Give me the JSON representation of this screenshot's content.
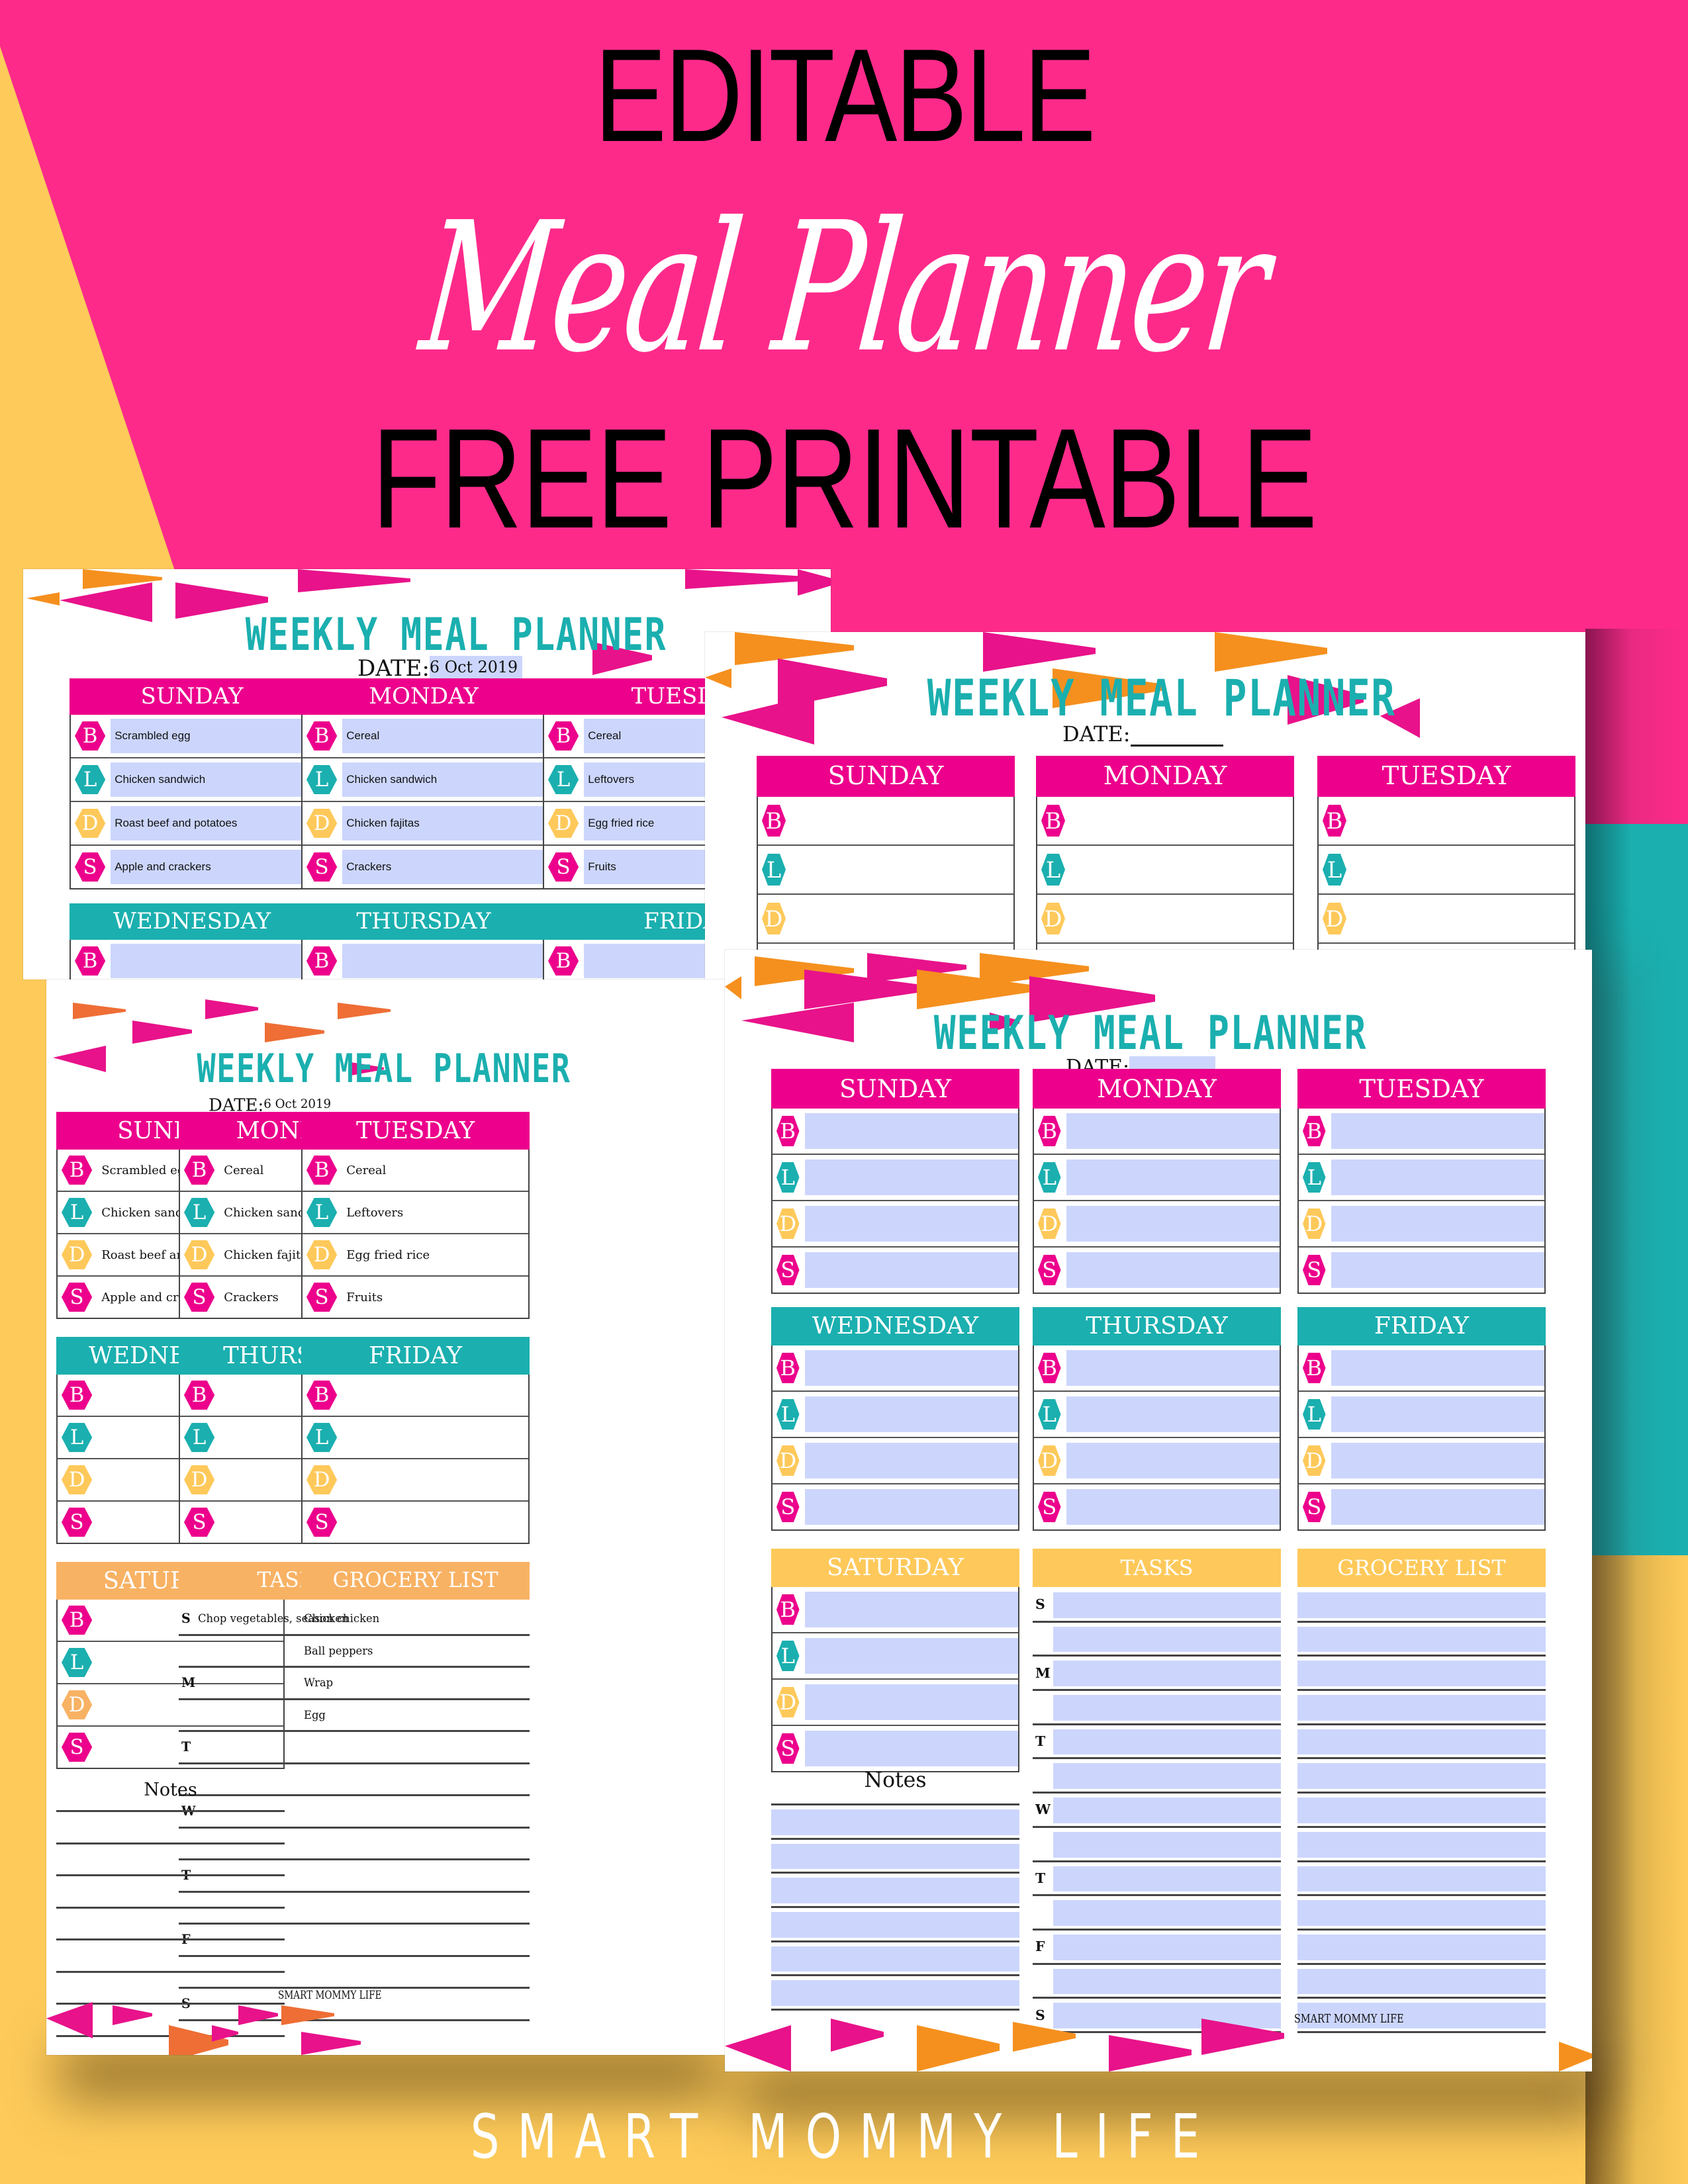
{
  "hero": {
    "line1": "EDITABLE",
    "line2": "Meal Planner",
    "line3": "FREE PRINTABLE"
  },
  "footer_brand": "SMART MOMMY LIFE",
  "colors": {
    "background_pink": "#FE2A8A",
    "background_yellow": "#FECB5A",
    "background_teal": "#1BAFAF",
    "header_pink": "#EC008C",
    "header_teal": "#1BAFAF",
    "header_yellow": "#FEC95A",
    "field_fill": "#CCD6FD",
    "title_teal": "#1BAFAF"
  },
  "meal_badges": [
    "B",
    "L",
    "D",
    "S"
  ],
  "task_day_letters": [
    "S",
    "M",
    "T",
    "W",
    "T",
    "F",
    "S"
  ],
  "pages": {
    "back_left": {
      "title": "WEEKLY MEAL PLANNER",
      "date_label": "DATE:",
      "date_value": "6 Oct 2019",
      "days": [
        {
          "name": "SUNDAY",
          "meals": [
            "Scrambled egg",
            "Chicken sandwich",
            "Roast beef and potatoes",
            "Apple and crackers"
          ]
        },
        {
          "name": "MONDAY",
          "meals": [
            "Cereal",
            "Chicken sandwich",
            "Chicken fajitas",
            "Crackers"
          ]
        },
        {
          "name": "TUESDAY",
          "meals": [
            "Cereal",
            "Leftovers",
            "Egg fried rice",
            "Fruits"
          ]
        },
        {
          "name": "WEDNESDAY",
          "meals": [
            "",
            "",
            "",
            ""
          ]
        },
        {
          "name": "THURSDAY",
          "meals": [
            "",
            "",
            "",
            ""
          ]
        },
        {
          "name": "FRIDAY",
          "meals": [
            "",
            "",
            "",
            ""
          ]
        }
      ]
    },
    "back_right": {
      "title": "WEEKLY MEAL PLANNER",
      "date_label": "DATE:",
      "date_value": "",
      "days": [
        {
          "name": "SUNDAY",
          "meals": [
            "",
            "",
            "",
            ""
          ]
        },
        {
          "name": "MONDAY",
          "meals": [
            "",
            "",
            "",
            ""
          ]
        },
        {
          "name": "TUESDAY",
          "meals": [
            "",
            "",
            "",
            ""
          ]
        }
      ]
    },
    "front_left": {
      "title": "WEEKLY MEAL PLANNER",
      "date_label": "DATE:",
      "date_value": "6 Oct 2019",
      "days": [
        {
          "name": "SUNDAY",
          "meals": [
            "Scrambled egg",
            "Chicken sandwich",
            "Roast beef and potatoes",
            "Apple and crackers"
          ]
        },
        {
          "name": "MONDAY",
          "meals": [
            "Cereal",
            "Chicken sandwich",
            "Chicken fajitas",
            "Crackers"
          ]
        },
        {
          "name": "TUESDAY",
          "meals": [
            "Cereal",
            "Leftovers",
            "Egg fried rice",
            "Fruits"
          ]
        },
        {
          "name": "WEDNESDAY",
          "meals": [
            "",
            "",
            "",
            ""
          ]
        },
        {
          "name": "THURSDAY",
          "meals": [
            "",
            "",
            "",
            ""
          ]
        },
        {
          "name": "FRIDAY",
          "meals": [
            "",
            "",
            "",
            ""
          ]
        },
        {
          "name": "SATURDAY",
          "meals": [
            "",
            "",
            "",
            ""
          ]
        }
      ],
      "tasks_label": "TASKS",
      "tasks": [
        {
          "day": "S",
          "text": "Chop vegetables, season chicken"
        },
        {
          "day": "",
          "text": ""
        },
        {
          "day": "M",
          "text": ""
        },
        {
          "day": "",
          "text": ""
        },
        {
          "day": "T",
          "text": ""
        },
        {
          "day": "",
          "text": ""
        },
        {
          "day": "W",
          "text": ""
        },
        {
          "day": "",
          "text": ""
        },
        {
          "day": "T",
          "text": ""
        },
        {
          "day": "",
          "text": ""
        },
        {
          "day": "F",
          "text": ""
        },
        {
          "day": "",
          "text": ""
        },
        {
          "day": "S",
          "text": ""
        }
      ],
      "grocery_label": "GROCERY LIST",
      "grocery": [
        "Chicken",
        "Ball peppers",
        "Wrap",
        "Egg",
        "",
        "",
        "",
        "",
        "",
        "",
        "",
        "",
        ""
      ],
      "notes_label": "Notes",
      "notes": [
        "",
        "",
        "",
        "",
        "",
        "",
        "",
        ""
      ],
      "brand": "SMART MOMMY LIFE"
    },
    "front_right": {
      "title": "WEEKLY MEAL PLANNER",
      "date_label": "DATE:",
      "date_value": "",
      "days": [
        {
          "name": "SUNDAY",
          "meals": [
            "",
            "",
            "",
            ""
          ]
        },
        {
          "name": "MONDAY",
          "meals": [
            "",
            "",
            "",
            ""
          ]
        },
        {
          "name": "TUESDAY",
          "meals": [
            "",
            "",
            "",
            ""
          ]
        },
        {
          "name": "WEDNESDAY",
          "meals": [
            "",
            "",
            "",
            ""
          ]
        },
        {
          "name": "THURSDAY",
          "meals": [
            "",
            "",
            "",
            ""
          ]
        },
        {
          "name": "FRIDAY",
          "meals": [
            "",
            "",
            "",
            ""
          ]
        },
        {
          "name": "SATURDAY",
          "meals": [
            "",
            "",
            "",
            ""
          ]
        }
      ],
      "tasks_label": "TASKS",
      "tasks": [
        {
          "day": "S",
          "text": ""
        },
        {
          "day": "",
          "text": ""
        },
        {
          "day": "M",
          "text": ""
        },
        {
          "day": "",
          "text": ""
        },
        {
          "day": "T",
          "text": ""
        },
        {
          "day": "",
          "text": ""
        },
        {
          "day": "W",
          "text": ""
        },
        {
          "day": "",
          "text": ""
        },
        {
          "day": "T",
          "text": ""
        },
        {
          "day": "",
          "text": ""
        },
        {
          "day": "F",
          "text": ""
        },
        {
          "day": "",
          "text": ""
        },
        {
          "day": "S",
          "text": ""
        }
      ],
      "grocery_label": "GROCERY LIST",
      "grocery": [
        "",
        "",
        "",
        "",
        "",
        "",
        "",
        "",
        "",
        "",
        "",
        "",
        ""
      ],
      "notes_label": "Notes",
      "notes": [
        "",
        "",
        "",
        "",
        "",
        ""
      ],
      "brand": "SMART MOMMY LIFE"
    }
  }
}
